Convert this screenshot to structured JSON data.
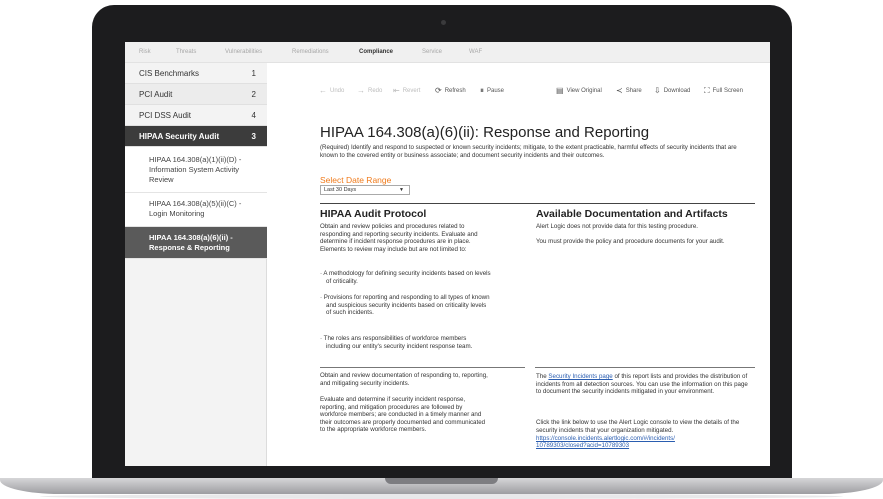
{
  "topnav": {
    "items": [
      "Risk",
      "Threats",
      "Vulnerabilities",
      "Remediations",
      "Compliance",
      "Service",
      "WAF"
    ],
    "active": "Compliance"
  },
  "sidebar": {
    "items": [
      {
        "label": "CIS Benchmarks",
        "count": "1"
      },
      {
        "label": "PCI Audit",
        "count": "2"
      },
      {
        "label": "PCI DSS Audit",
        "count": "4"
      },
      {
        "label": "HIPAA Security Audit",
        "count": "3"
      }
    ],
    "subitems": [
      "HIPAA 164.308(a)(1)(ii)(D) - Information System Activity Review",
      "HIPAA 164.308(a)(5)(ii)(C) - Login Monitoring",
      "HIPAA 164.308(a)(6)(ii) - Response & Reporting"
    ]
  },
  "toolbar": {
    "undo": "Undo",
    "redo": "Redo",
    "revert": "Revert",
    "refresh": "Refresh",
    "pause": "Pause",
    "view_original": "View Original",
    "share": "Share",
    "download": "Download",
    "full_screen": "Full Screen"
  },
  "main": {
    "title": "HIPAA 164.308(a)(6)(ii): Response and Reporting",
    "description": "(Required) Identify and respond to suspected or known security incidents; mitigate, to the extent practicable, harmful effects of security incidents that are known to the covered entity or business associate; and document security incidents and their outcomes.",
    "date_range_label": "Select Date Range",
    "date_range_value": "Last 30 Days",
    "protocol_heading": "HIPAA Audit Protocol",
    "protocol_intro": "Obtain and review policies and procedures related to responding and reporting security incidents. Evaluate and determine if incident response procedures are in place. Elements to review may include but are not limited to:",
    "bullets": [
      "· A methodology for defining security incidents based on levels of criticality.",
      "· Provisions for reporting and responding to all types of known and suspicious security incidents based on criticality levels of such incidents.",
      "· The roles ans responsibilities of workforce members including our entity's security incident response team."
    ],
    "protocol_2a": "Obtain and review documentation of responding to, reporting, and mitigating security incidents.",
    "protocol_2b": "Evaluate and determine if security incident response, reporting, and mitigation procedures are followed by workforce members; are conducted in a timely manner and their outcomes are properly documented and communicated to the appropriate workforce members.",
    "docs_heading": "Available Documentation and Artifacts",
    "docs_1": "Alert Logic does not provide data for this testing procedure.",
    "docs_2": "You must provide the policy and procedure documents for your audit.",
    "docs_3_pre": "The ",
    "docs_3_link": "Security Incidents page",
    "docs_3_post": " of this report lists and provides the distribution of incidents from all detection sources. You can use the information on this page to document the security incidents mitigated in your environment.",
    "docs_4": "Click the link below to use the Alert Logic console to view the details of the security incidents that your organization mitigated.",
    "docs_url": "https://console.incidents.alertlogic.com/#/incidents/",
    "docs_url2": "10789303/closed?acid=10789303"
  }
}
